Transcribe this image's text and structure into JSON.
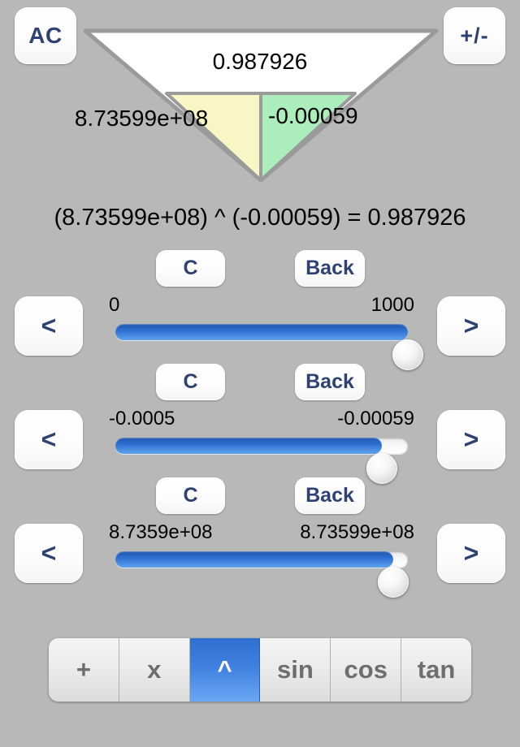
{
  "topbar": {
    "all_clear_label": "AC",
    "sign_toggle_label": "+/-"
  },
  "display": {
    "result": "0.987926",
    "operand_left": "8.73599e+08",
    "operand_right": "-0.00059",
    "colors": {
      "outer_fill": "#ffffff",
      "left_fill": "#f7f6c4",
      "right_fill": "#abeebc",
      "outline": "#9a9a9a",
      "background": "#b8b8b8",
      "accent": "#2e4272",
      "selected": "#3f80e0"
    }
  },
  "equation": "(8.73599e+08) ^ (-0.00059) = 0.987926",
  "slider_rows": [
    {
      "clear_label": "C",
      "back_label": "Back",
      "prev_label": "<",
      "next_label": ">",
      "min_label": "0",
      "max_label": "1000",
      "fill_percent": 100
    },
    {
      "clear_label": "C",
      "back_label": "Back",
      "prev_label": "<",
      "next_label": ">",
      "min_label": "-0.0005",
      "max_label": "-0.00059",
      "fill_percent": 91
    },
    {
      "clear_label": "C",
      "back_label": "Back",
      "prev_label": "<",
      "next_label": ">",
      "min_label": "8.7359e+08",
      "max_label": "8.73599e+08",
      "fill_percent": 95
    }
  ],
  "operators": [
    {
      "label": "+",
      "selected": false
    },
    {
      "label": "x",
      "selected": false
    },
    {
      "label": "^",
      "selected": true
    },
    {
      "label": "sin",
      "selected": false
    },
    {
      "label": "cos",
      "selected": false
    },
    {
      "label": "tan",
      "selected": false
    }
  ]
}
